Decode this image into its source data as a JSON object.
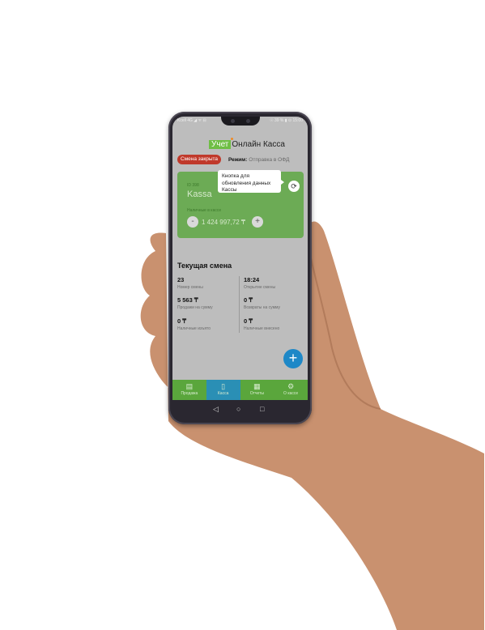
{
  "status_bar": {
    "left": "Kcell 4G ◢ ᯤ ⊟",
    "right": "☉ 39 % ▮ ⊙ 15:00"
  },
  "app": {
    "brand_tag": "Учет",
    "brand_name": "Онлайн Касса",
    "shift_status": "Смена закрыта",
    "mode_label": "Режим:",
    "mode_value": "Отправка в ОФД"
  },
  "card": {
    "small_label": "ID 398",
    "kassa_name": "Kassa",
    "cash_label": "Наличные в кассе",
    "minus_label": "-",
    "plus_label": "+",
    "amount": "1 424 997,72 ₸",
    "tooltip": "Кнопка для обновления данных Кассы",
    "refresh_icon": "refresh-icon"
  },
  "current_shift": {
    "title": "Текущая смена",
    "stats": [
      {
        "value": "23",
        "label": "Номер смены"
      },
      {
        "value": "18:24",
        "label": "Открытие смены"
      },
      {
        "value": "5 563 ₸",
        "label": "Продажи на сумму"
      },
      {
        "value": "0 ₸",
        "label": "Возвраты на сумму"
      },
      {
        "value": "0 ₸",
        "label": "Наличные изъято"
      },
      {
        "value": "0 ₸",
        "label": "Наличные внесено"
      }
    ]
  },
  "fab_label": "+",
  "nav": [
    {
      "label": "Продажа",
      "icon": "receipt-icon"
    },
    {
      "label": "Касса",
      "icon": "cash-register-icon"
    },
    {
      "label": "Отчеты",
      "icon": "reports-icon"
    },
    {
      "label": "О кассе",
      "icon": "gear-icon"
    }
  ],
  "system_nav": {
    "back": "◁",
    "home": "○",
    "recent": "□"
  },
  "colors": {
    "accent_green": "#6cab55",
    "badge_red": "#c0392b",
    "fab_blue": "#1e88c7",
    "nav_active": "#2a8fb5"
  }
}
